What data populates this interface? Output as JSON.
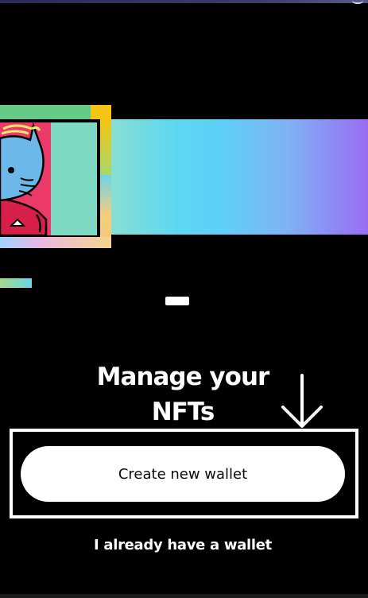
{
  "onboarding": {
    "title": "Manage your NFTs",
    "title_line1": "Manage your",
    "title_line2": "NFTs",
    "current_page": 1,
    "hero": {
      "icon": "nft-cat-artwork-icon"
    }
  },
  "actions": {
    "create_wallet_label": "Create new wallet",
    "existing_wallet_label": "I already have a wallet"
  },
  "annotation": {
    "arrow_icon": "down-arrow-icon",
    "highlight_target": "create-wallet-button"
  },
  "colors": {
    "background": "#000000",
    "primary_button_bg": "#ffffff",
    "primary_button_text": "#0b0b0b",
    "gradient_start": "#8de0d0",
    "gradient_mid": "#5cd7f2",
    "gradient_end": "#9a6cf3"
  }
}
